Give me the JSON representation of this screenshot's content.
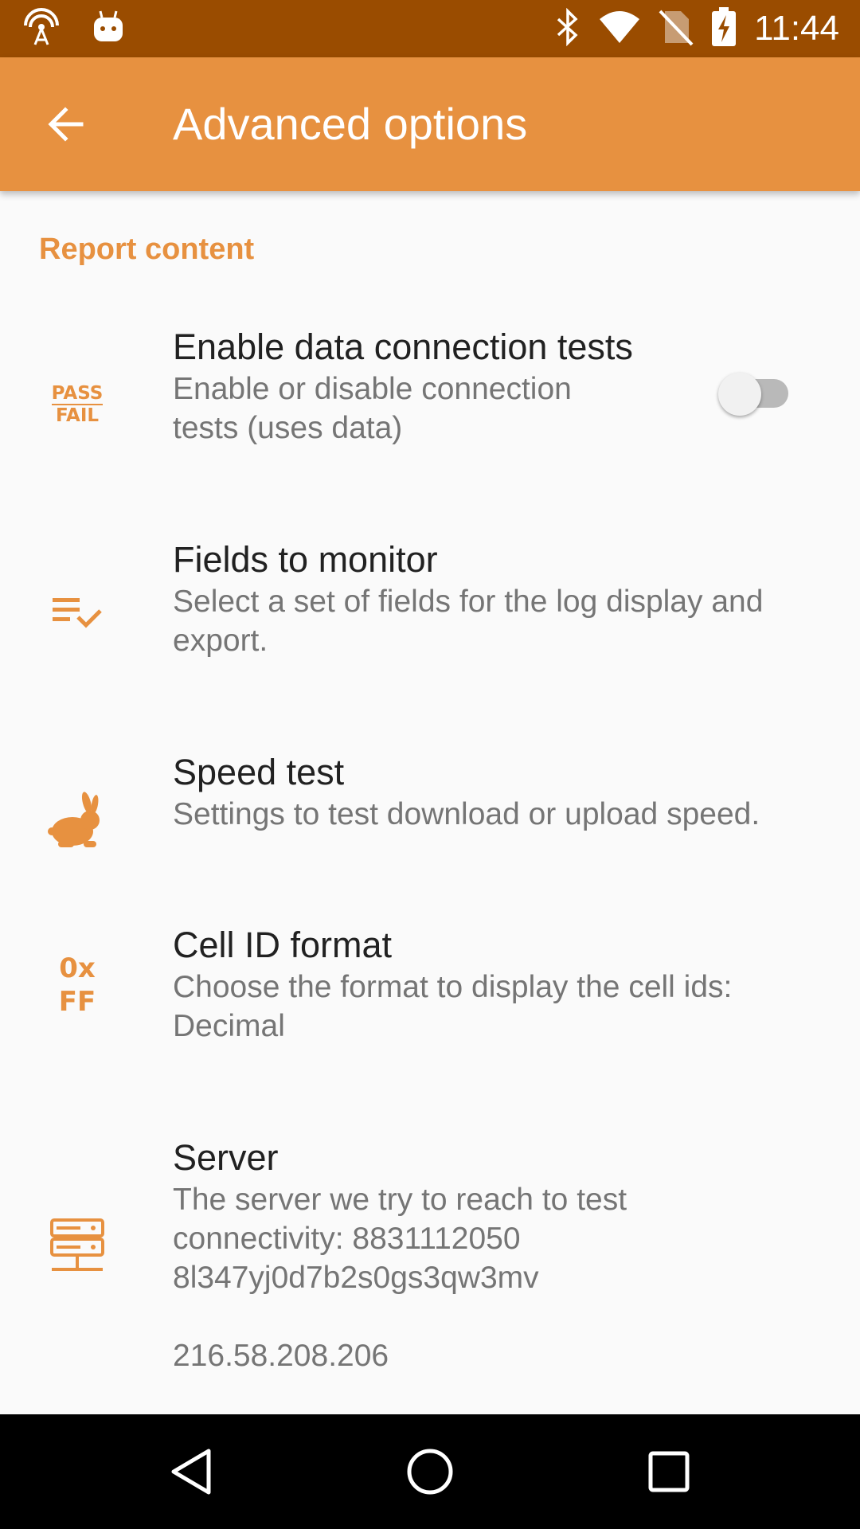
{
  "status_bar": {
    "icons": [
      "hotspot-icon",
      "android-icon",
      "bluetooth-icon",
      "wifi-icon",
      "no-sim-icon",
      "battery-charging-icon"
    ],
    "time": "11:44"
  },
  "app_bar": {
    "back_icon": "arrow-back-icon",
    "title": "Advanced options",
    "background": "#e79140"
  },
  "content": {
    "category": "Report content",
    "prefs": [
      {
        "icon": "pass-fail-icon",
        "icon_text_top": "PASS",
        "icon_text_bottom": "FAIL",
        "title": "Enable data connection tests",
        "summary_lines": [
          "Enable or disable connection",
          "tests (uses data)"
        ],
        "toggle_on": false
      },
      {
        "icon": "checklist-icon",
        "title": "Fields to monitor",
        "summary_lines": [
          "Select a set of fields for the log display and",
          "export."
        ]
      },
      {
        "icon": "rabbit-icon",
        "title": "Speed test",
        "summary_lines": [
          "Settings to test download or upload speed."
        ]
      },
      {
        "icon": "hex-format-icon",
        "icon_text_top": "0x",
        "icon_text_bottom": "FF",
        "title": "Cell ID format",
        "summary_lines": [
          "Choose the format to display the cell ids:",
          "Decimal"
        ]
      },
      {
        "icon": "server-icon",
        "title": "Server",
        "summary_lines": [
          "The server we try to reach to test",
          "connectivity: 8831112050",
          "8l347yj0d7b2s0gs3qw3mv",
          "",
          "216.58.208.206"
        ]
      }
    ]
  },
  "nav_bar": {
    "back_icon": "nav-back-icon",
    "home_icon": "nav-home-icon",
    "recents_icon": "nav-recents-icon"
  },
  "colors": {
    "status_bar": "#9a4c00",
    "accent": "#e79140",
    "title_text": "#212121",
    "summary_text": "#757575"
  }
}
